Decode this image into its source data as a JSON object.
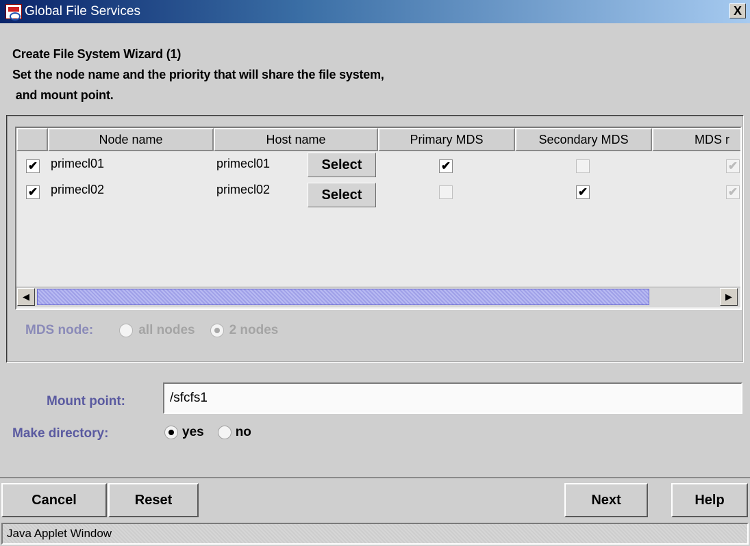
{
  "window": {
    "title": "Global File Services",
    "close_label": "X"
  },
  "header": {
    "line1": "Create File System Wizard (1)",
    "line2": "Set the node name and the priority that will share the file system,",
    "line3": " and mount point."
  },
  "table": {
    "columns": [
      "",
      "Node name",
      "Host name",
      "Primary MDS",
      "Secondary MDS",
      "MDS r"
    ],
    "rows": [
      {
        "checked": true,
        "node": "primecl01",
        "host": "primecl01",
        "select_label": "Select",
        "primary": true,
        "secondary": false,
        "mds_r": true
      },
      {
        "checked": true,
        "node": "primecl02",
        "host": "primecl02",
        "select_label": "Select",
        "primary": false,
        "secondary": true,
        "mds_r": true
      }
    ]
  },
  "mds_node": {
    "label": "MDS node:",
    "options": [
      {
        "label": "all nodes",
        "selected": false
      },
      {
        "label": "2 nodes",
        "selected": true
      }
    ]
  },
  "mount_point": {
    "label": "Mount point:",
    "value": "/sfcfs1"
  },
  "make_directory": {
    "label": "Make directory:",
    "options": [
      {
        "label": "yes",
        "selected": true
      },
      {
        "label": "no",
        "selected": false
      }
    ]
  },
  "buttons": {
    "cancel": "Cancel",
    "reset": "Reset",
    "next": "Next",
    "help": "Help"
  },
  "status": {
    "text": "Java Applet Window"
  },
  "glyphs": {
    "check": "✔",
    "arrow_left": "◀",
    "arrow_right": "▶"
  }
}
